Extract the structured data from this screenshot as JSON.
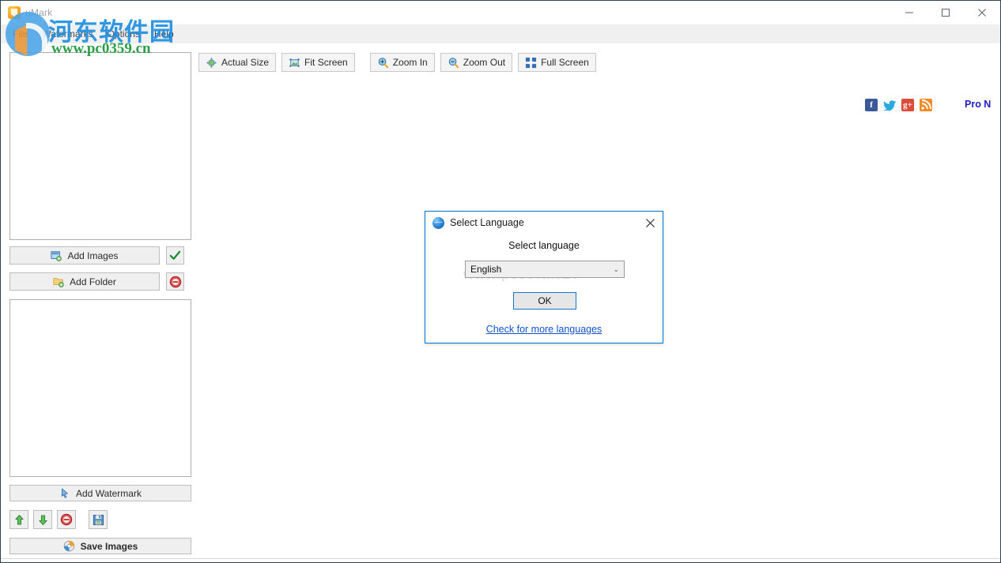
{
  "window": {
    "title": "uMark",
    "icon": "umark-app-icon",
    "controls": {
      "minimize": "minimize-icon",
      "maximize": "maximize-icon",
      "close": "close-icon"
    }
  },
  "menubar": {
    "items": [
      {
        "label": "File"
      },
      {
        "label": "Watermarks"
      },
      {
        "label": "Options"
      },
      {
        "label": "Help"
      }
    ]
  },
  "toolbar": {
    "buttons": [
      {
        "label": "Actual Size",
        "icon": "actual-size-icon"
      },
      {
        "label": "Fit Screen",
        "icon": "fit-screen-icon"
      },
      {
        "label": "Zoom In",
        "icon": "zoom-in-icon"
      },
      {
        "label": "Zoom Out",
        "icon": "zoom-out-icon"
      },
      {
        "label": "Full Screen",
        "icon": "full-screen-icon"
      }
    ],
    "social": [
      {
        "name": "facebook-icon",
        "glyph": "f"
      },
      {
        "name": "twitter-icon",
        "glyph": "✈"
      },
      {
        "name": "google-plus-icon",
        "glyph": "g+"
      },
      {
        "name": "rss-icon",
        "glyph": "◠"
      }
    ],
    "pro_label": "Pro N"
  },
  "sidebar": {
    "add_images": {
      "label": "Add Images",
      "icon": "add-images-icon"
    },
    "add_folder": {
      "label": "Add Folder",
      "icon": "add-folder-icon"
    },
    "check_button": {
      "icon": "check-icon"
    },
    "remove_button": {
      "icon": "remove-circle-icon"
    },
    "add_watermark": {
      "label": "Add Watermark",
      "icon": "watermark-cursor-icon"
    },
    "move_up": {
      "icon": "arrow-up-icon"
    },
    "move_down": {
      "icon": "arrow-down-icon"
    },
    "delete": {
      "icon": "remove-circle-icon"
    },
    "save_preset": {
      "icon": "floppy-disk-icon"
    },
    "save_images": {
      "label": "Save Images",
      "icon": "save-images-icon"
    },
    "images_list_placeholder": "",
    "watermarks_list_placeholder": ""
  },
  "dialog": {
    "title": "Select Language",
    "title_icon": "globe-icon",
    "close_icon": "close-icon",
    "label": "Select language",
    "select": {
      "value": "English",
      "chevron": "⌄",
      "options": [
        "English"
      ]
    },
    "ok_label": "OK",
    "link_label": "Check for more languages",
    "background_watermark": "www.pcsoft.NET"
  },
  "watermark_overlay": {
    "site_name_cn": "河东软件园",
    "site_url": "www.pc0359.cn",
    "logo": "pc0359-logo-icon"
  },
  "colors": {
    "accent": "#0078d7",
    "link": "#1054c8",
    "pro_text": "#2020c0",
    "menubar_bg": "#f0f0f0",
    "button_bg": "#efefef",
    "border": "#bcbcbc"
  }
}
